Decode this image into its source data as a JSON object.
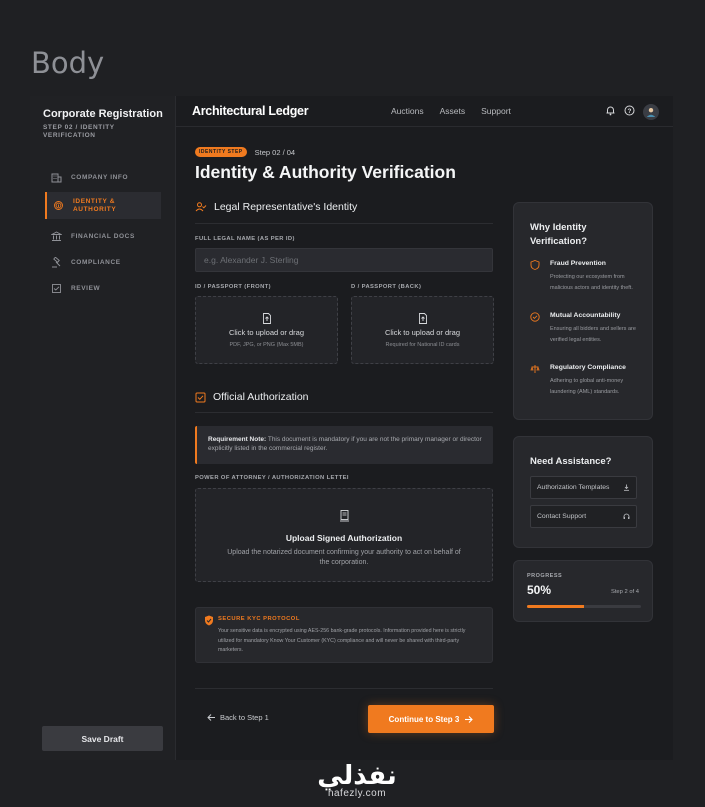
{
  "frame_label": "Body",
  "sidebar": {
    "title": "Corporate Registration",
    "step": "STEP 02 / IDENTITY VERIFICATION",
    "items": [
      {
        "label": "COMPANY INFO",
        "icon": "building-icon",
        "active": false
      },
      {
        "label": "IDENTITY & AUTHORITY",
        "icon": "fingerprint-icon",
        "active": true
      },
      {
        "label": "FINANCIAL DOCS",
        "icon": "bank-icon",
        "active": false
      },
      {
        "label": "COMPLIANCE",
        "icon": "gavel-icon",
        "active": false
      },
      {
        "label": "REVIEW",
        "icon": "review-icon",
        "active": false
      }
    ],
    "save_label": "Save Draft"
  },
  "topbar": {
    "brand": "Architectural Ledger",
    "nav": [
      "Auctions",
      "Assets",
      "Support"
    ],
    "icons": [
      "bell-icon",
      "help-icon",
      "avatar"
    ]
  },
  "main": {
    "badge": "IDENTITY STEP",
    "step_text": "Step 02 / 04",
    "title": "Identity & Authority Verification",
    "section1": {
      "title": "Legal Representative's Identity",
      "name_label": "FULL LEGAL NAME (AS PER ID)",
      "name_placeholder": "e.g. Alexander J. Sterling",
      "front_label": "ID / PASSPORT (FRONT)",
      "back_label": "D / PASSPORT (BACK)",
      "front_upload": {
        "title": "Click to upload or drag",
        "sub": "PDF, JPG, or PNG (Max 5MB)"
      },
      "back_upload": {
        "title": "Click to upload or drag",
        "sub": "Required for National ID cards"
      }
    },
    "section2": {
      "title": "Official Authorization",
      "note_bold": "Requirement Note:",
      "note_text": " This document is mandatory if you are not the primary manager or director explicitly listed in the commercial register.",
      "poa_label": "POWER OF ATTORNEY / AUTHORIZATION LETTEI",
      "poa_title": "Upload Signed Authorization",
      "poa_sub": "Upload the notarized document confirming your authority to act on behalf of the corporation."
    },
    "kyc": {
      "head": "SECURE KYC PROTOCOL",
      "body": "Your sensitive data is encrypted using AES-256 bank-grade protocols. Information provided here is strictly utilized for mandatory Know Your Customer (KYC) compliance and will never be shared with third-party marketers."
    },
    "back_label": "Back to Step 1",
    "continue_label": "Continue to Step 3"
  },
  "why": {
    "title": "Why Identity Verification?",
    "items": [
      {
        "title": "Fraud Prevention",
        "desc": "Protecting our ecosystem from malicious actors and identity theft."
      },
      {
        "title": "Mutual Accountability",
        "desc": "Ensuring all bidders and sellers are verified legal entities."
      },
      {
        "title": "Regulatory Compliance",
        "desc": "Adhering to global anti-money laundering (AML) standards."
      }
    ]
  },
  "assist": {
    "title": "Need Assistance?",
    "templates": "Authorization Templates",
    "contact": "Contact Support"
  },
  "progress": {
    "label": "PROGRESS",
    "percent_text": "50%",
    "value": 0.5,
    "step": "Step 2 of 4"
  },
  "watermark": {
    "arabic": "نفذلي",
    "latin": "nafezly.com"
  },
  "colors": {
    "accent": "#f07a1f",
    "bg": "#1b1c1f",
    "card": "#27282c"
  }
}
